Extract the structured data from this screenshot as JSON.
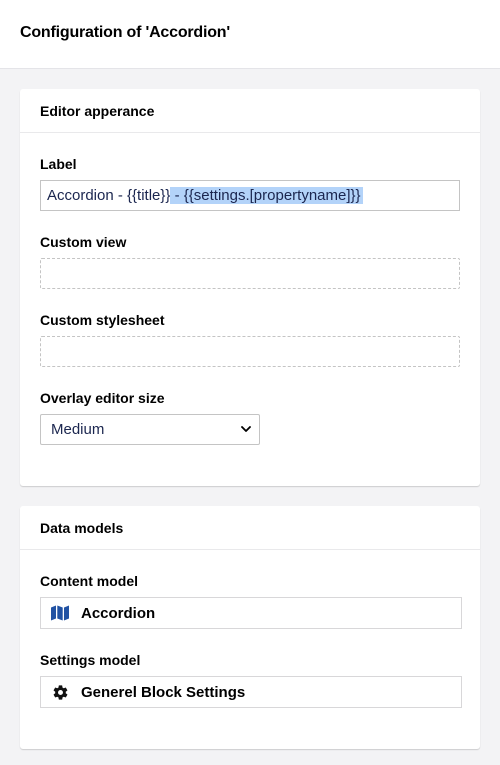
{
  "header": {
    "title": "Configuration of 'Accordion'"
  },
  "editor_appearance": {
    "title": "Editor apperance",
    "label": {
      "label": "Label",
      "value_plain": "Accordion - {{title}}",
      "value_selected": " - {{settings.[propertyname]}}"
    },
    "custom_view": {
      "label": "Custom view",
      "value": ""
    },
    "custom_stylesheet": {
      "label": "Custom stylesheet",
      "value": ""
    },
    "overlay_size": {
      "label": "Overlay editor size",
      "selected": "Medium"
    }
  },
  "data_models": {
    "title": "Data models",
    "content_model": {
      "label": "Content model",
      "name": "Accordion",
      "icon": "map-icon"
    },
    "settings_model": {
      "label": "Settings model",
      "name": "Generel Block Settings",
      "icon": "gear-icon"
    }
  },
  "colors": {
    "accent_blue": "#2152a3",
    "selection": "#b3d3f9",
    "text": "#1b264f"
  }
}
